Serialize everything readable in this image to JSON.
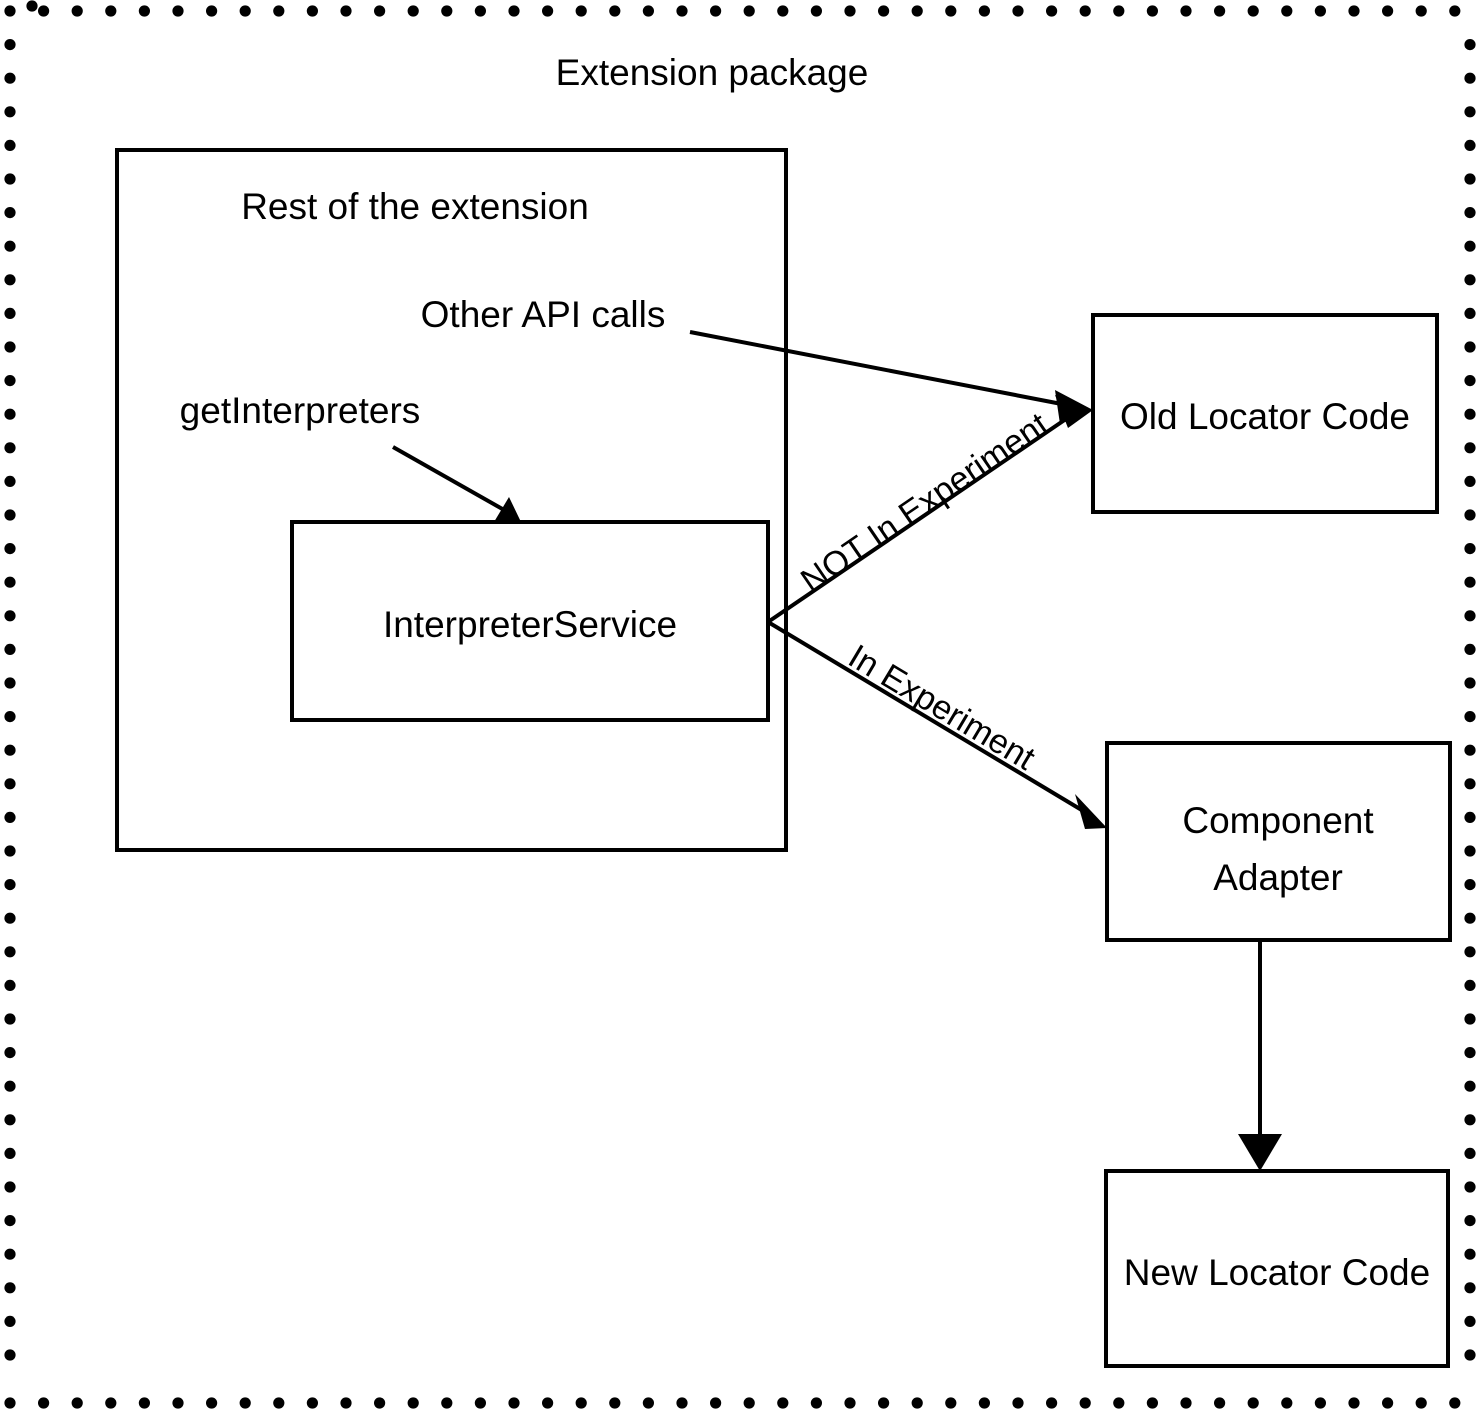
{
  "diagram": {
    "title": "Extension package",
    "container_label": "Rest of the extension",
    "boxes": {
      "interpreter_service": "InterpreterService",
      "old_locator_code": "Old Locator Code",
      "component_adapter_line1": "Component",
      "component_adapter_line2": "Adapter",
      "new_locator_code": "New Locator Code"
    },
    "captions": {
      "other_api_calls": "Other API calls",
      "get_interpreters": "getInterpreters"
    },
    "edge_labels": {
      "not_in_experiment": "NOT In Experiment",
      "in_experiment": "In Experiment"
    },
    "colors": {
      "stroke": "#000000",
      "fill": "#ffffff",
      "background": "#ffffff"
    }
  }
}
